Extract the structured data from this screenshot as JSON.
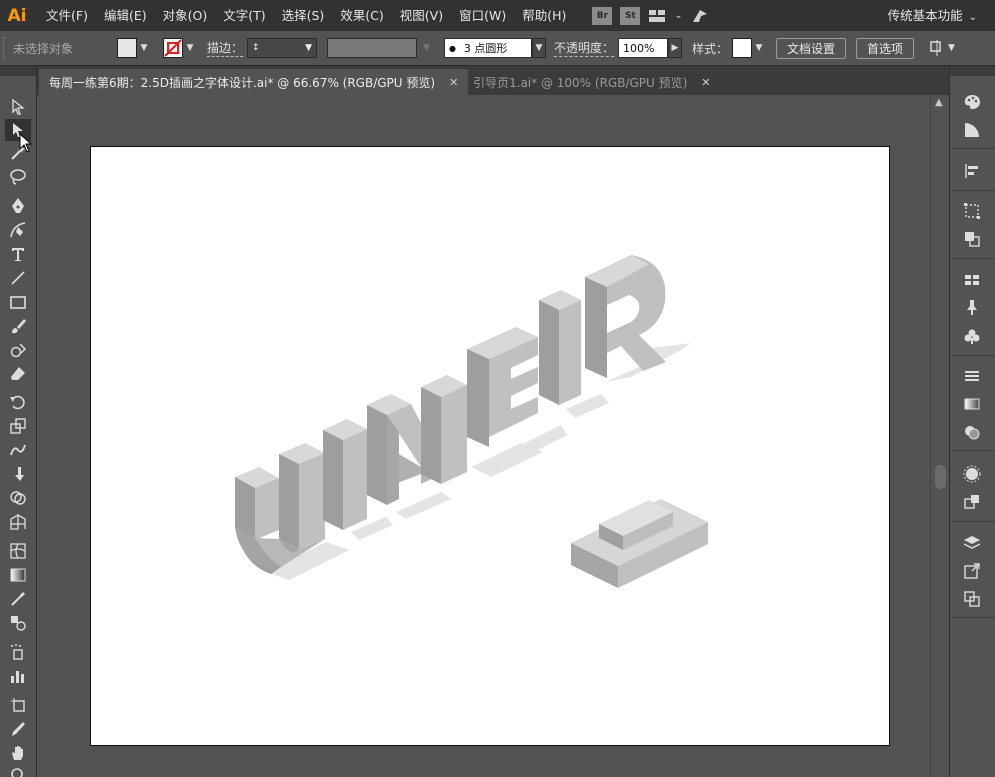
{
  "app": {
    "logo": "Ai",
    "workspace": "传统基本功能"
  },
  "menu": [
    "文件(F)",
    "编辑(E)",
    "对象(O)",
    "文字(T)",
    "选择(S)",
    "效果(C)",
    "视图(V)",
    "窗口(W)",
    "帮助(H)"
  ],
  "menu_right": {
    "br": "Br",
    "st": "St"
  },
  "control": {
    "no_selection": "未选择对象",
    "stroke_label": "描边：",
    "brush_value": "3 点圆形",
    "opacity_label": "不透明度：",
    "opacity_value": "100%",
    "style_label": "样式：",
    "doc_setup": "文档设置",
    "preferences": "首选项"
  },
  "tabs": [
    {
      "label": "每周一练第6期：2.5D插画之字体设计.ai* @ 66.67% (RGB/GPU 预览)",
      "active": true
    },
    {
      "label": "引导页1.ai* @ 100% (RGB/GPU 预览)",
      "active": false
    }
  ],
  "colors": {
    "accent": "#ff9a00",
    "face_top": "#dcdcdc",
    "face_left": "#a7a7a7",
    "face_right": "#c4c4c4",
    "shadow": "#e6e6e6"
  }
}
